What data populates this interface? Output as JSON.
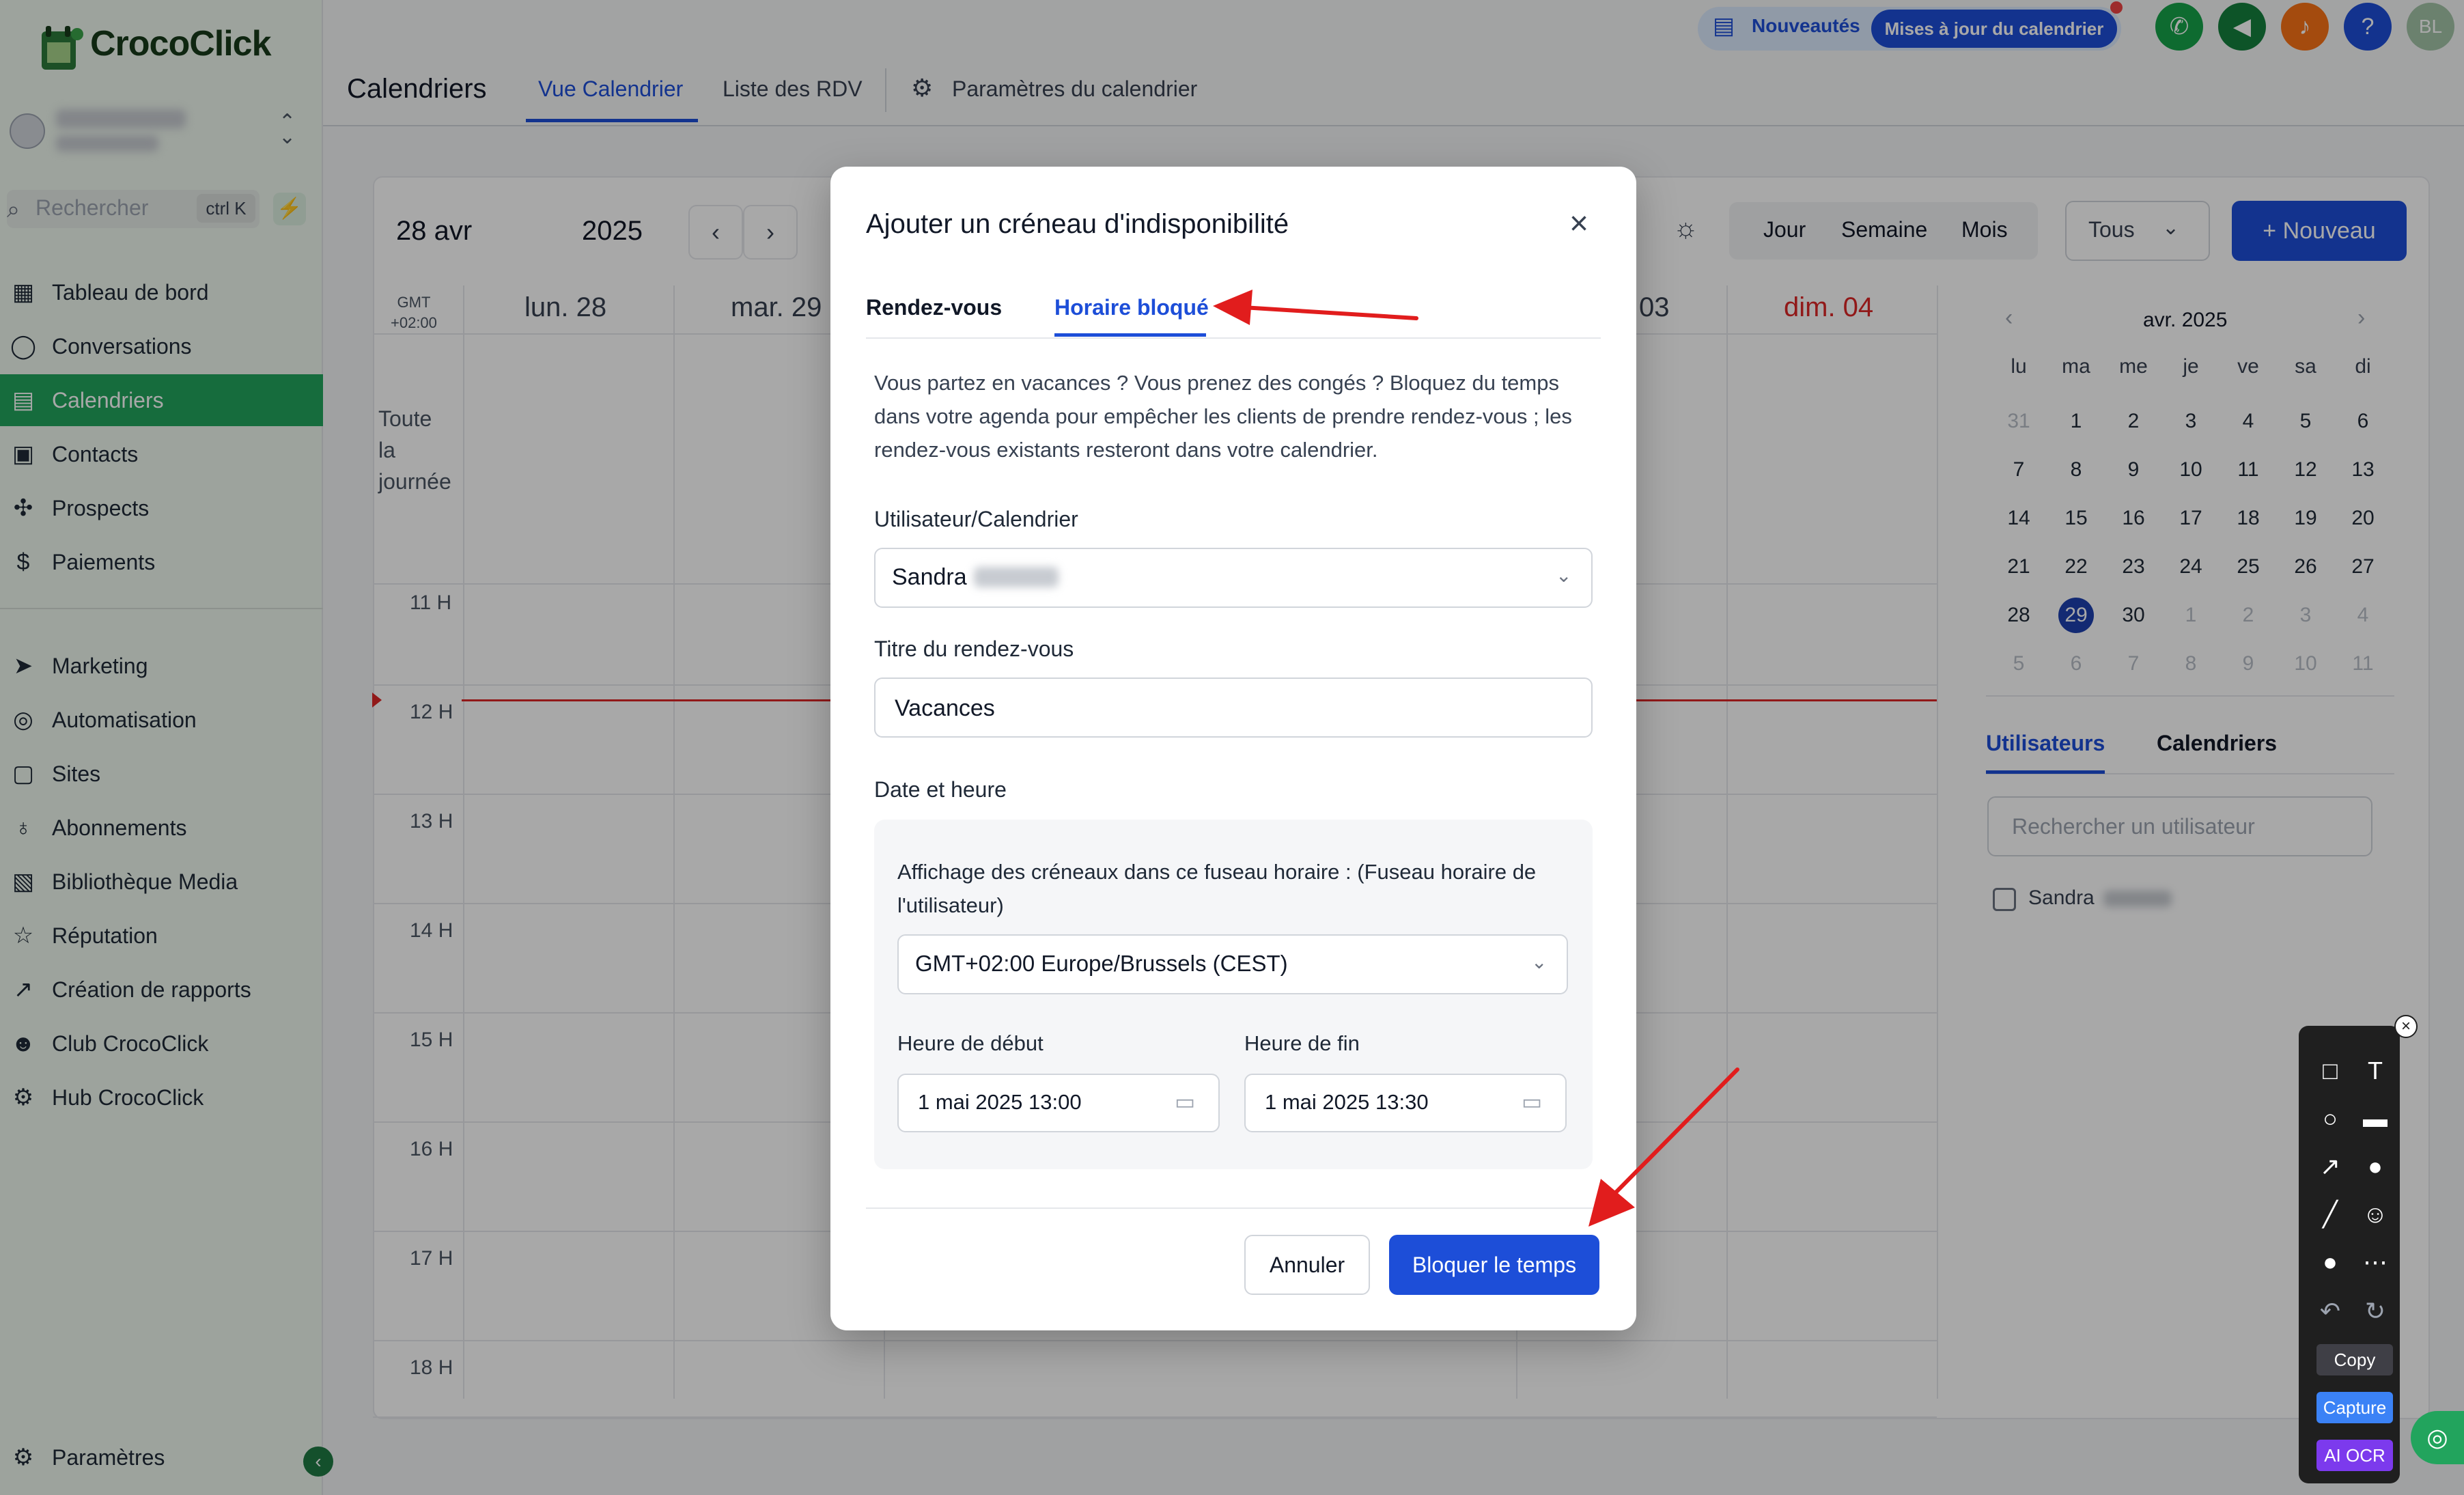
{
  "app": {
    "brand": "CrocoClick",
    "search_placeholder": "Rechercher",
    "search_shortcut": "ctrl K"
  },
  "sidebar": {
    "items": [
      {
        "label": "Tableau de bord",
        "icon": "dashboard-icon"
      },
      {
        "label": "Conversations",
        "icon": "chat-icon"
      },
      {
        "label": "Calendriers",
        "icon": "calendar-icon",
        "active": true
      },
      {
        "label": "Contacts",
        "icon": "contacts-icon"
      },
      {
        "label": "Prospects",
        "icon": "prospects-icon"
      },
      {
        "label": "Paiements",
        "icon": "payments-icon"
      },
      {
        "label": "Marketing",
        "icon": "send-icon"
      },
      {
        "label": "Automatisation",
        "icon": "automation-icon"
      },
      {
        "label": "Sites",
        "icon": "sites-icon"
      },
      {
        "label": "Abonnements",
        "icon": "subscriptions-icon"
      },
      {
        "label": "Bibliothèque Media",
        "icon": "media-icon"
      },
      {
        "label": "Réputation",
        "icon": "star-icon"
      },
      {
        "label": "Création de rapports",
        "icon": "reports-icon"
      },
      {
        "label": "Club CrocoClick",
        "icon": "club-icon"
      },
      {
        "label": "Hub CrocoClick",
        "icon": "hub-icon"
      }
    ],
    "settings_label": "Paramètres"
  },
  "header": {
    "title": "Calendriers",
    "tabs": [
      "Vue Calendrier",
      "Liste des RDV"
    ],
    "settings_tab": "Paramètres du calendrier",
    "news_label": "Nouveautés",
    "update_label": "Mises à jour du calendrier",
    "avatar_initials": "BL",
    "help_label": "?"
  },
  "calendar": {
    "date_label": "28 avr",
    "year_label": "2025",
    "tz_line1": "GMT",
    "tz_line2": "+02:00",
    "day_headers": [
      "lun. 28",
      "mar. 29",
      "03",
      "dim. 04"
    ],
    "all_day": [
      "Toute",
      "la",
      "journée"
    ],
    "hours": [
      "11 H",
      "12 H",
      "13 H",
      "14 H",
      "15 H",
      "16 H",
      "17 H",
      "18 H"
    ],
    "views": [
      "Jour",
      "Semaine",
      "Mois"
    ],
    "filter": "Tous",
    "new_button": "Nouveau",
    "weekend_color": "#dc2626"
  },
  "mini_calendar": {
    "title": "avr. 2025",
    "weekdays": [
      "lu",
      "ma",
      "me",
      "je",
      "ve",
      "sa",
      "di"
    ],
    "weeks": [
      [
        "31",
        "1",
        "2",
        "3",
        "4",
        "5",
        "6"
      ],
      [
        "7",
        "8",
        "9",
        "10",
        "11",
        "12",
        "13"
      ],
      [
        "14",
        "15",
        "16",
        "17",
        "18",
        "19",
        "20"
      ],
      [
        "21",
        "22",
        "23",
        "24",
        "25",
        "26",
        "27"
      ],
      [
        "28",
        "29",
        "30",
        "1",
        "2",
        "3",
        "4"
      ],
      [
        "5",
        "6",
        "7",
        "8",
        "9",
        "10",
        "11"
      ]
    ],
    "today": "29"
  },
  "users_panel": {
    "tabs": [
      "Utilisateurs",
      "Calendriers"
    ],
    "search_placeholder": "Rechercher un utilisateur",
    "user": "Sandra"
  },
  "modal": {
    "title": "Ajouter un créneau d'indisponibilité",
    "tabs": [
      "Rendez-vous",
      "Horaire bloqué"
    ],
    "description": "Vous partez en vacances ? Vous prenez des congés ? Bloquez du temps dans votre agenda pour empêcher les clients de prendre rendez-vous ; les rendez-vous existants resteront dans votre calendrier.",
    "user_label": "Utilisateur/Calendrier",
    "user_value": "Sandra",
    "title_label": "Titre du rendez-vous",
    "title_value": "Vacances",
    "datetime_label": "Date et heure",
    "tz_label": "Affichage des créneaux dans ce fuseau horaire : (Fuseau horaire de l'utilisateur)",
    "tz_value": "GMT+02:00 Europe/Brussels (CEST)",
    "start_label": "Heure de début",
    "start_value": "1 mai 2025 13:00",
    "end_label": "Heure de fin",
    "end_value": "1 mai 2025 13:30",
    "cancel": "Annuler",
    "submit": "Bloquer le temps"
  },
  "annotation_toolbar": {
    "copy": "Copy",
    "capture": "Capture",
    "ocr": "AI OCR"
  }
}
